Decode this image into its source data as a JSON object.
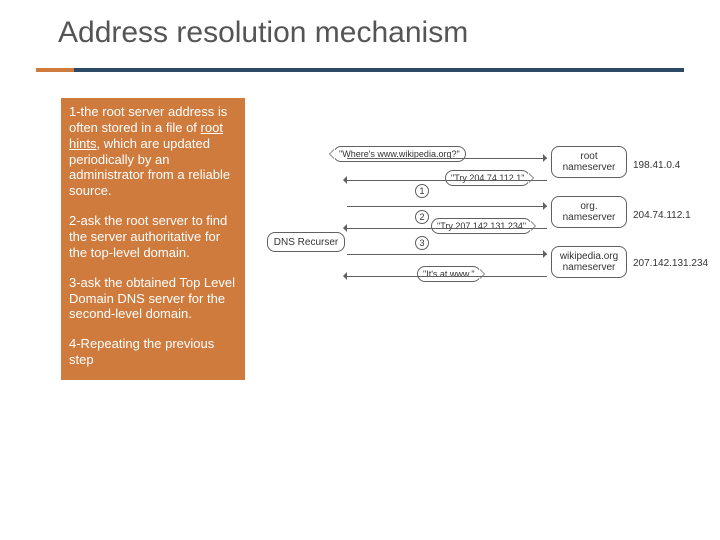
{
  "title": "Address resolution mechanism",
  "panel": {
    "p1_a": "1-the root server address is often stored in a file of ",
    "p1_em": "root hints",
    "p1_b": ", which are updated periodically by an administrator from a reliable source.",
    "p2": "2-ask the root server to find the server authoritative for the top-level domain.",
    "p3": "3-ask the obtained Top Level Domain DNS server for the second-level domain.",
    "p4": "4-Repeating the previous step"
  },
  "diagram": {
    "recurser": "DNS Recurser",
    "question": "\"Where's www.wikipedia.org?\"",
    "try1": "\"Try 204.74.112.1\"",
    "try2": "\"Try 207.142.131.234\"",
    "ref": "\"It's at www.\"",
    "ns1": {
      "label": "root\nnameserver",
      "ip": "198.41.0.4"
    },
    "ns2": {
      "label": "org.\nnameserver",
      "ip": "204.74.112.1"
    },
    "ns3": {
      "label": "wikipedia.org\nnameserver",
      "ip": "207.142.131.234"
    },
    "steps": {
      "n1": "1",
      "n2": "2",
      "n3": "3"
    }
  }
}
